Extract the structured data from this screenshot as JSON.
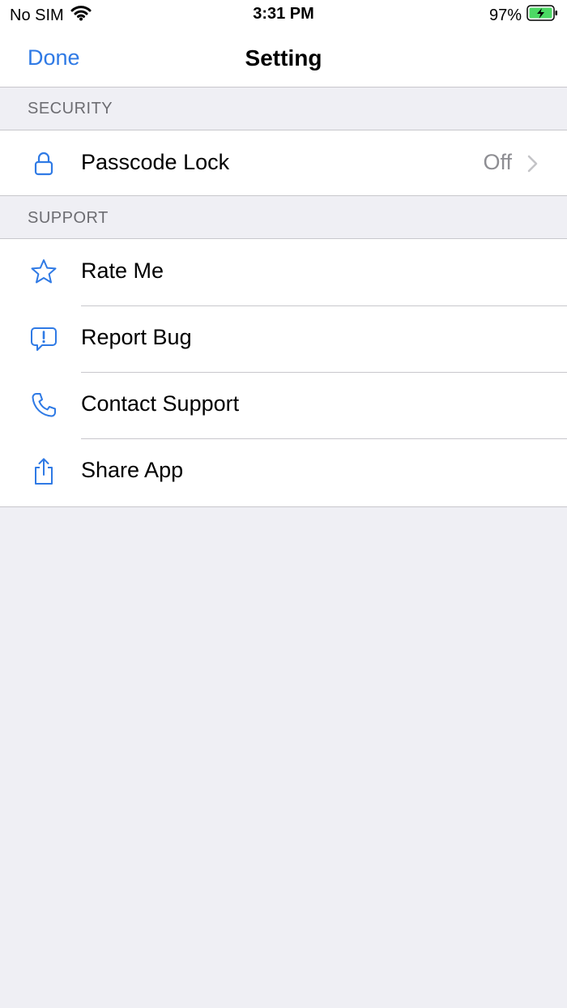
{
  "status_bar": {
    "carrier": "No SIM",
    "time": "3:31 PM",
    "battery": "97%"
  },
  "nav": {
    "done_label": "Done",
    "title": "Setting"
  },
  "sections": {
    "security": {
      "header": "SECURITY",
      "passcode": {
        "label": "Passcode Lock",
        "value": "Off"
      }
    },
    "support": {
      "header": "SUPPORT",
      "rate": {
        "label": "Rate Me"
      },
      "report": {
        "label": "Report Bug"
      },
      "contact": {
        "label": "Contact Support"
      },
      "share": {
        "label": "Share App"
      }
    }
  },
  "colors": {
    "accent": "#2f7ae5",
    "background": "#efeff4",
    "battery_fill": "#4cd964"
  }
}
